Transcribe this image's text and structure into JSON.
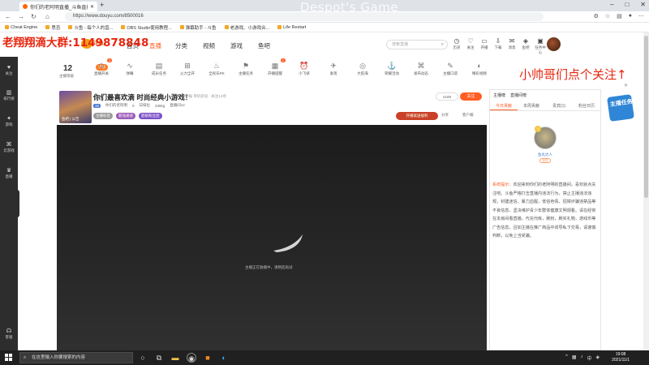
{
  "browser": {
    "tab_title": "你们的老阿明直播_斗鱼直播",
    "url": "https://www.douyu.com/8500016",
    "bookmarks": [
      "Cheat Engine",
      "思否",
      "斗鱼 - 每个人的直...",
      "OBS Studio使用教程...",
      "弹幕助手 - 斗鱼",
      "老游戏、小游戏合...",
      "Life Restart"
    ]
  },
  "overlays": {
    "title": "Despot's Game",
    "left_banner": "老翔翔滴大群:1149878848",
    "right_banner": "小帅哥们点个关注↑"
  },
  "sidebar": {
    "items": [
      "关注",
      "排行榜",
      "游戏",
      "云游戏",
      "直播",
      "客服"
    ]
  },
  "header": {
    "nav": [
      "首页",
      "直播",
      "分类",
      "视频",
      "游戏",
      "鱼吧"
    ],
    "search_placeholder": "搜索直播",
    "icons": [
      "历史",
      "关注",
      "开播",
      "下载",
      "消息",
      "鱼吧",
      "任务中心"
    ]
  },
  "toolbar": {
    "level": "12",
    "level_label": "主播等级",
    "level_pill": "贵族",
    "items": [
      "直播开关",
      "弹幕",
      "成长任务",
      "火力全开",
      "全民乐PK",
      "主播任务",
      "开播提醒",
      "小飞侠",
      "发现",
      "大航海",
      "荣耀活动",
      "发布动态",
      "主播口袋",
      "精彩视频"
    ],
    "badges": {
      "0": "3",
      "5": "2"
    }
  },
  "room": {
    "title": "你们最喜欢滴 时尚经典小游戏！",
    "meta": "举报   单机杂谈 · 关注12场",
    "anchor_tag": "16",
    "anchor": "你们的老阿明",
    "hot": "0",
    "rank": "日排位",
    "weight": "236kg",
    "extra": "直播间12",
    "tags": [
      "主播标签",
      "超强通道",
      "超级粉丝团"
    ],
    "thumb_label": "鱼吧 | 公告",
    "follow_count": "4189",
    "follow_label": "关注",
    "promo_pill": "开播就送福利",
    "share": "分享",
    "client": "客户端"
  },
  "video": {
    "message": "主播正在独播中，请稍后再试"
  },
  "right_panel": {
    "top": [
      "主播榜",
      "直播间榜"
    ],
    "tabs": [
      "今日贡献",
      "本周贡献",
      "贵宾(1)",
      "粉丝日历"
    ],
    "rank_no": "1",
    "rank_name": "鱼丸达人",
    "rank_btn": "前排",
    "sys_label": "系统提示：",
    "sys_text": "欢迎来到你们的老阿明的直播间，喜欢就点关注吧。斗鱼严格打击直播内违法行为，禁止主播违法违规，封建迷信，暴力血腥，低俗色情，招嫖诈骗违禁品等不良信息，坚决维护青少年群体健康文明观看。请在经常在本房间看直播，代充代练，刷粉，刷买礼物，游戏币等广告信息，且如主播在推广商品中诱导私下交易，请谨慎判断，以免上当受骗。"
  },
  "promo": {
    "badge_text": "主播任务"
  },
  "taskbar": {
    "search": "在这里输入你要搜索的内容",
    "time": "19:08",
    "date": "2021/11/1"
  }
}
